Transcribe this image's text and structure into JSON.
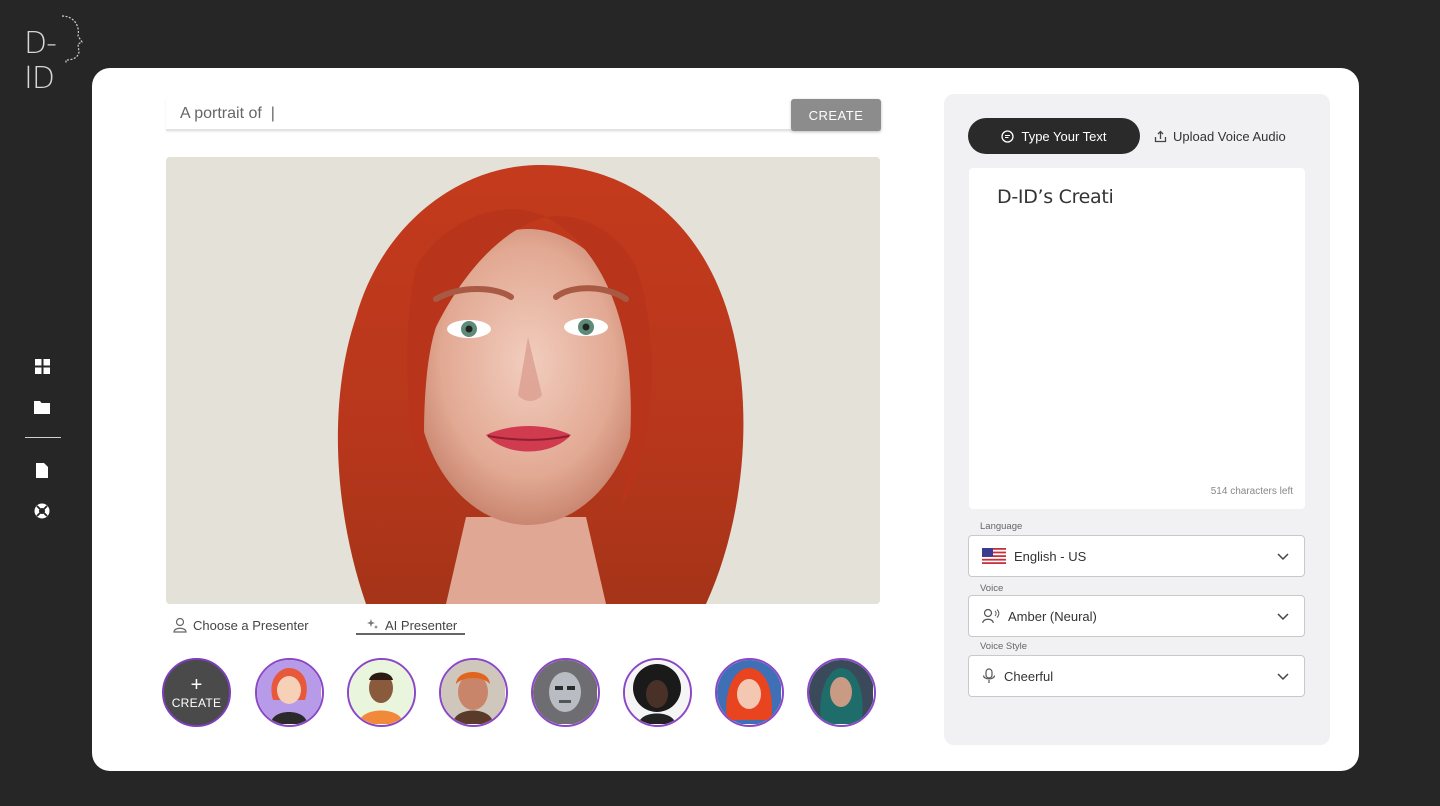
{
  "brand": {
    "logo_text": "D-ID"
  },
  "sidebar": {
    "icons": [
      "grid-icon",
      "folder-icon",
      "document-icon",
      "help-lifebuoy-icon"
    ]
  },
  "prompt": {
    "value": "",
    "placeholder": "A portrait of  |",
    "create_label": "CREATE"
  },
  "presenter_tabs": {
    "choose_label": "Choose a Presenter",
    "ai_label": "AI Presenter",
    "active": "AI Presenter"
  },
  "avatars": {
    "create_plus": "+",
    "create_label": "CREATE",
    "items": [
      "avatar-cartoon-redhead",
      "avatar-cartoon-man",
      "avatar-orange-hair-man",
      "avatar-robot",
      "avatar-woman-afro",
      "avatar-redhead-girl",
      "avatar-fantasy-woman"
    ]
  },
  "panel": {
    "tab_type_label": "Type Your Text",
    "tab_upload_label": "Upload Voice Audio",
    "text_value": "D-ID’s Creati",
    "chars_left": "514 characters left",
    "language_label": "Language",
    "language_value": "English - US",
    "voice_label": "Voice",
    "voice_value": "Amber (Neural)",
    "style_label": "Voice Style",
    "style_value": "Cheerful"
  },
  "colors": {
    "page_bg": "#262626",
    "card_bg": "#ffffff",
    "panel_bg": "#f1f1f4",
    "avatar_ring": "#8a48c6",
    "create_btn": "#8c8c8c",
    "active_tab": "#2a2a2a"
  }
}
